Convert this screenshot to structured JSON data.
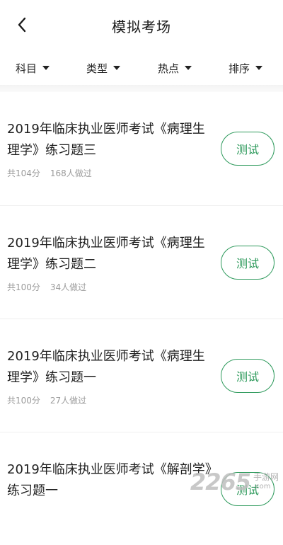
{
  "header": {
    "title": "模拟考场"
  },
  "filters": [
    {
      "label": "科目"
    },
    {
      "label": "类型"
    },
    {
      "label": "热点"
    },
    {
      "label": "排序"
    }
  ],
  "exams": [
    {
      "title": "2019年临床执业医师考试《病理生理学》练习题三",
      "score": "共104分",
      "count": "168人做过",
      "action": "测试"
    },
    {
      "title": "2019年临床执业医师考试《病理生理学》练习题二",
      "score": "共100分",
      "count": "34人做过",
      "action": "测试"
    },
    {
      "title": "2019年临床执业医师考试《病理生理学》练习题一",
      "score": "共100分",
      "count": "27人做过",
      "action": "测试"
    },
    {
      "title": "2019年临床执业医师考试《解剖学》练习题一",
      "score": "",
      "count": "",
      "action": "测试"
    }
  ],
  "watermark": {
    "number": "2265",
    "cn": "手游网",
    "en": ".com"
  },
  "colors": {
    "accent": "#2e9a5c",
    "meta_text": "#9a9a9a"
  }
}
